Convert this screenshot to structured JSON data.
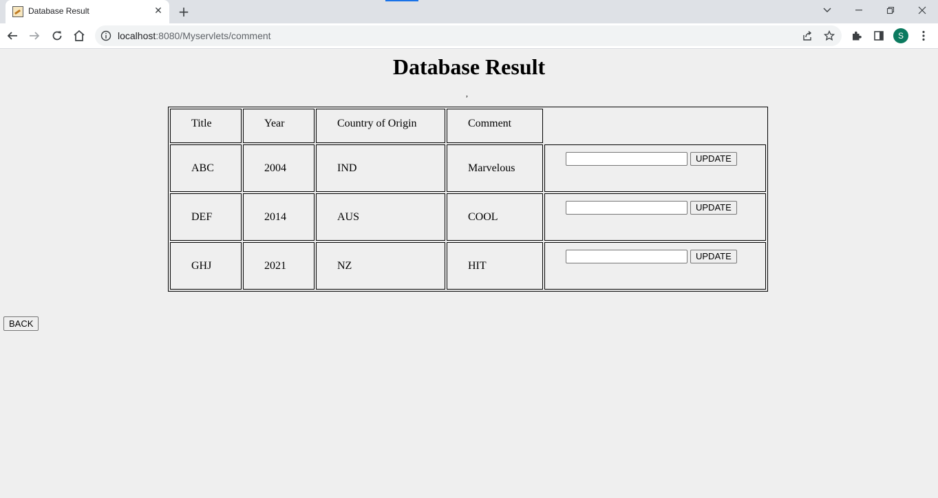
{
  "browser": {
    "tab_title": "Database Result",
    "tab_close_glyph": "✕",
    "new_tab_glyph": "+",
    "url_host": "localhost",
    "url_path": ":8080/Myservlets/comment",
    "profile_initial": "S",
    "icons": [
      "back-arrow-icon",
      "forward-arrow-icon",
      "reload-icon",
      "home-icon",
      "site-info-icon",
      "share-icon",
      "bookmark-star-icon",
      "extensions-icon",
      "side-panel-icon",
      "menu-icon",
      "tab-search-icon",
      "minimize-icon",
      "restore-icon",
      "close-window-icon"
    ]
  },
  "page": {
    "title": "Database Result",
    "stray_mark": ",",
    "table": {
      "headers": [
        "Title",
        "Year",
        "Country of Origin",
        "Comment"
      ],
      "rows": [
        {
          "title": "ABC",
          "year": "2004",
          "country": "IND",
          "comment": "Marvelous",
          "input_value": "",
          "button_label": "UPDATE"
        },
        {
          "title": "DEF",
          "year": "2014",
          "country": "AUS",
          "comment": "COOL",
          "input_value": "",
          "button_label": "UPDATE"
        },
        {
          "title": "GHJ",
          "year": "2021",
          "country": "NZ",
          "comment": "HIT",
          "input_value": "",
          "button_label": "UPDATE"
        }
      ]
    },
    "back_label": "BACK"
  },
  "colors": {
    "tabstrip": "#dee1e6",
    "page_background": "#efefef",
    "avatar": "#0b7a5f",
    "accent": "#1a73e8"
  }
}
